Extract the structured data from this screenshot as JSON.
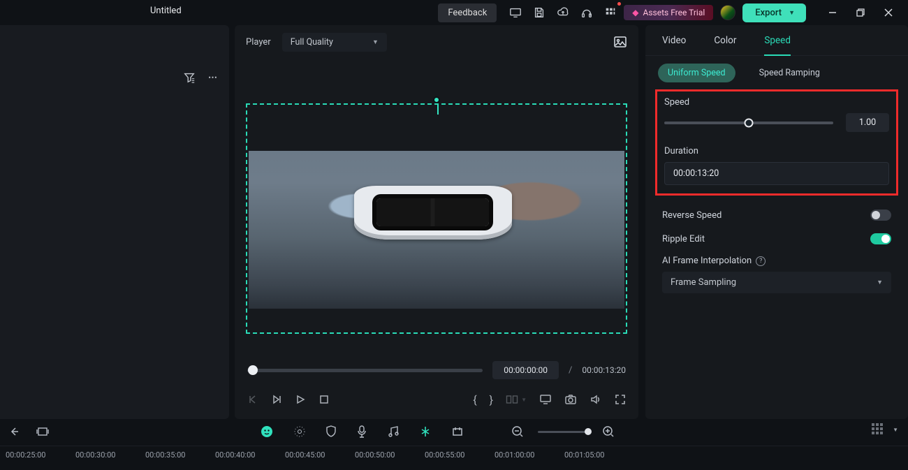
{
  "app": {
    "title": "Untitled"
  },
  "topbar": {
    "feedback": "Feedback",
    "assets_trial": "Assets Free Trial",
    "export": "Export"
  },
  "leftpanel": {},
  "player": {
    "label": "Player",
    "quality": "Full Quality",
    "current_time": "00:00:00:00",
    "total_time": "00:00:13:20"
  },
  "inspector": {
    "tabs": {
      "video": "Video",
      "color": "Color",
      "speed": "Speed"
    },
    "subtabs": {
      "uniform": "Uniform Speed",
      "ramping": "Speed Ramping"
    },
    "speed_label": "Speed",
    "speed_value": "1.00",
    "duration_label": "Duration",
    "duration_value": "00:00:13:20",
    "reverse_label": "Reverse Speed",
    "ripple_label": "Ripple Edit",
    "ai_label": "AI Frame Interpolation",
    "ai_value": "Frame Sampling"
  },
  "timeline": {
    "markers": [
      "00:00:25:00",
      "00:00:30:00",
      "00:00:35:00",
      "00:00:40:00",
      "00:00:45:00",
      "00:00:50:00",
      "00:00:55:00",
      "00:01:00:00",
      "00:01:05:00"
    ]
  }
}
